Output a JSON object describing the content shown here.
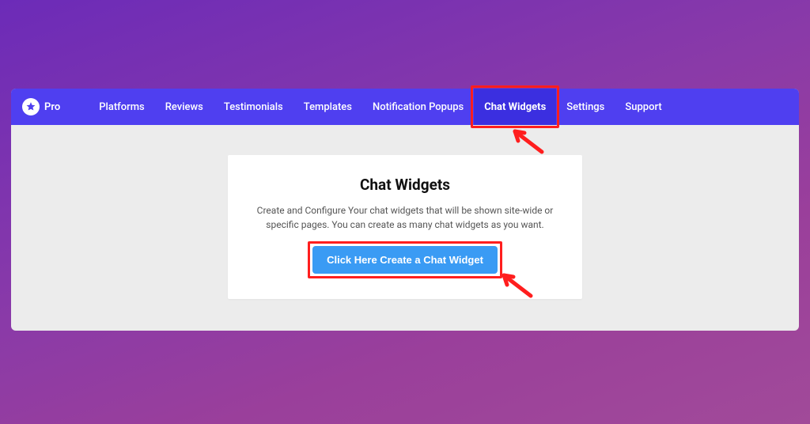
{
  "brand": {
    "label": "Pro"
  },
  "nav": {
    "items": [
      {
        "label": "Platforms"
      },
      {
        "label": "Reviews"
      },
      {
        "label": "Testimonials"
      },
      {
        "label": "Templates"
      },
      {
        "label": "Notification Popups"
      },
      {
        "label": "Chat Widgets",
        "active": true
      },
      {
        "label": "Settings"
      },
      {
        "label": "Support"
      }
    ]
  },
  "panel": {
    "title": "Chat Widgets",
    "description": "Create and Configure Your chat widgets that will be shown site-wide or specific pages. You can create as many chat widgets as you want.",
    "cta_label": "Click Here Create a Chat Widget"
  },
  "annotations": {
    "highlight_color": "#ff1e1e"
  }
}
